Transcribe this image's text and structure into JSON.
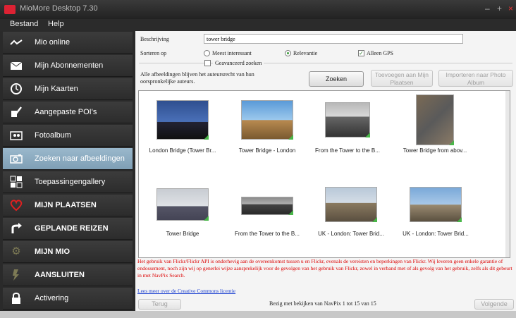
{
  "window": {
    "title": "MioMore Desktop 7.30",
    "controls": [
      "–",
      "+",
      "×"
    ]
  },
  "menu": [
    "Bestand",
    "Help"
  ],
  "sidebar": {
    "items": [
      {
        "label": "Mio online",
        "icon": "signal-icon"
      },
      {
        "label": "Mijn Abonnementen",
        "icon": "envelope-icon"
      },
      {
        "label": "Mijn Kaarten",
        "icon": "compass-icon"
      },
      {
        "label": "Aangepaste POI's",
        "icon": "pen-icon"
      },
      {
        "label": "Fotoalbum",
        "icon": "photo-album-icon"
      },
      {
        "label": "Zoeken naar afbeeldingen",
        "icon": "camera-icon",
        "active": true
      },
      {
        "label": "Toepassingengallery",
        "icon": "grid-icon"
      },
      {
        "label": "MIJN PLAATSEN",
        "icon": "heart-icon"
      },
      {
        "label": "GEPLANDE REIZEN",
        "icon": "route-icon"
      },
      {
        "label": "MIJN MIO",
        "icon": "gear-icon"
      },
      {
        "label": "AANSLUITEN",
        "icon": "lightning-icon"
      },
      {
        "label": "Activering",
        "icon": "lock-icon"
      }
    ]
  },
  "search": {
    "description_label": "Beschrijving",
    "description_value": "tower bridge",
    "sort_label": "Sorteren op",
    "sort_options": [
      "Meest interessant",
      "Relevantie"
    ],
    "sort_selected": "Relevantie",
    "only_gps_label": "Alleen GPS",
    "only_gps_checked": true,
    "advanced_label": "Geavanceerd zoeken",
    "copyright_note": "Alle afbeeldingen blijven het auteursrecht van hun oorspronkelijke auteurs.",
    "search_button": "Zoeken",
    "add_button": "Toevoegen aan Mijn Plaatsen",
    "import_button": "Importeren naar Photo Album"
  },
  "results": [
    {
      "caption": "London Bridge (Tower Br..."
    },
    {
      "caption": "Tower Bridge - London"
    },
    {
      "caption": "From the Tower to the B..."
    },
    {
      "caption": "Tower Bridge from abov..."
    },
    {
      "caption": "Tower Bridge"
    },
    {
      "caption": "From the Tower to the B..."
    },
    {
      "caption": "UK - London: Tower Brid..."
    },
    {
      "caption": "UK - London: Tower Brid..."
    }
  ],
  "disclaimer": "Het gebruik van Flickr/Flickr API is onderhevig aan de overeenkomst tussen u en Flickr, evenals de vereisten en beperkingen van Flickr. Wij leveren geen enkele garantie of endossement, noch zijn wij op generlei wijze aansprekelijk voor de gevolgen van het gebruik van Flickr, zowel in verband met of als gevolg van het gebruik, zelfs als dit gebeurt in met NavPix Search.",
  "cc_link": "Lees meer over de Creative Commons licentie",
  "pager": {
    "back": "Terug",
    "status": "Bezig met bekijken van NavPix 1 tot 15 van 15",
    "next": "Volgende"
  }
}
